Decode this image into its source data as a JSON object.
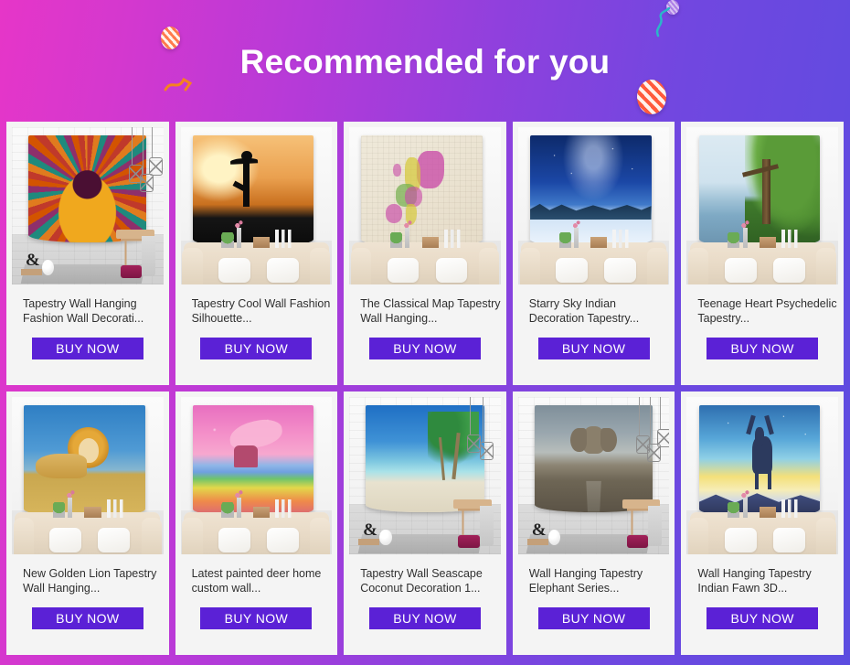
{
  "header": {
    "title": "Recommended for you",
    "decorations": [
      {
        "name": "confetti-ball-orange-small"
      },
      {
        "name": "confetti-squiggle-orange"
      },
      {
        "name": "confetti-ball-orange-large"
      },
      {
        "name": "confetti-ball-purple-small"
      },
      {
        "name": "confetti-squiggle-teal"
      }
    ],
    "gradient_from": "#e636c8",
    "gradient_to": "#5b4ce0"
  },
  "buy_label": "BUY NOW",
  "accent_button_color": "#5b21d6",
  "card_background": "#f4f4f4",
  "products": [
    {
      "title": "Tapestry Wall Hanging Fashion Wall Decorati...",
      "image_alt": "mandala-elephant-tapestry",
      "room": "brick",
      "buy_label": "BUY NOW"
    },
    {
      "title": "Tapestry Cool Wall Fashion Silhouette...",
      "image_alt": "yoga-sunset-silhouette-tapestry",
      "room": "sofa",
      "buy_label": "BUY NOW"
    },
    {
      "title": "The Classical Map Tapestry Wall Hanging...",
      "image_alt": "antique-europe-map-tapestry",
      "room": "sofa",
      "buy_label": "BUY NOW"
    },
    {
      "title": "Starry Sky Indian Decoration Tapestry...",
      "image_alt": "starry-sky-snow-forest-tapestry",
      "room": "sofa",
      "buy_label": "BUY NOW"
    },
    {
      "title": "Teenage Heart Psychedelic Tapestry...",
      "image_alt": "green-tree-lake-tapestry",
      "room": "sofa",
      "buy_label": "BUY NOW"
    },
    {
      "title": "New Golden Lion Tapestry Wall Hanging...",
      "image_alt": "golden-lion-savanna-tapestry",
      "room": "sofa",
      "buy_label": "BUY NOW"
    },
    {
      "title": "Latest painted deer home custom wall...",
      "image_alt": "pink-dolphin-pointillist-tapestry",
      "room": "sofa",
      "buy_label": "BUY NOW"
    },
    {
      "title": "Tapestry Wall Seascape Coconut Decoration 1...",
      "image_alt": "beach-palm-trees-tapestry",
      "room": "brick",
      "buy_label": "BUY NOW"
    },
    {
      "title": "Wall Hanging Tapestry Elephant Series...",
      "image_alt": "elephant-on-road-tapestry",
      "room": "brick",
      "buy_label": "BUY NOW"
    },
    {
      "title": "Wall Hanging Tapestry Indian Fawn 3D...",
      "image_alt": "deer-silhouette-sunrise-tapestry",
      "room": "sofa",
      "buy_label": "BUY NOW"
    }
  ]
}
